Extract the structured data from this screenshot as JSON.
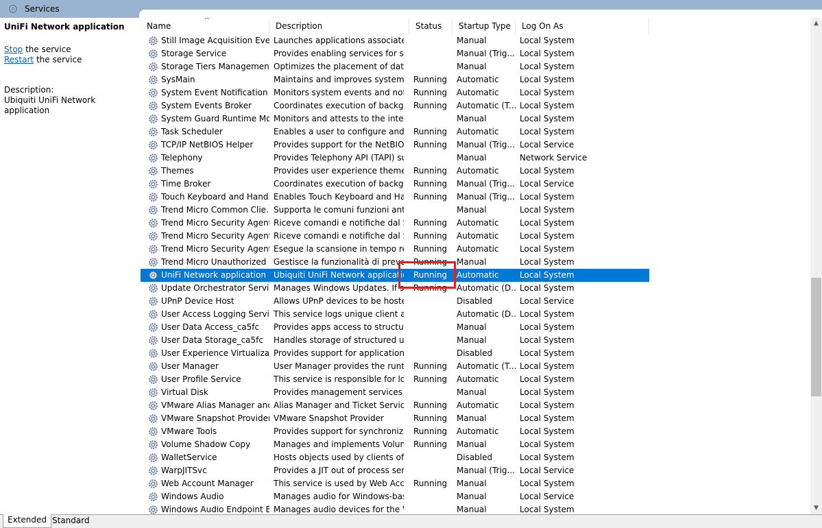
{
  "window": {
    "title": "Services",
    "icon": "gear-icon"
  },
  "left_pane": {
    "service_title": "UniFi Network application",
    "actions": [
      {
        "link": "Stop",
        "rest": " the service"
      },
      {
        "link": "Restart",
        "rest": " the service"
      }
    ],
    "description_label": "Description:",
    "description_text": "Ubiquiti UniFi Network application"
  },
  "columns": {
    "name": "Name",
    "description": "Description",
    "status": "Status",
    "startup_type": "Startup Type",
    "log_on_as": "Log On As",
    "sort_indicator": "^"
  },
  "services": [
    {
      "name": "Still Image Acquisition Events",
      "description": "Launches applications associated ...",
      "status": "",
      "startup": "Manual",
      "logon": "Local System"
    },
    {
      "name": "Storage Service",
      "description": "Provides enabling services for stor...",
      "status": "",
      "startup": "Manual (Trig...",
      "logon": "Local System"
    },
    {
      "name": "Storage Tiers Management",
      "description": "Optimizes the placement of data i...",
      "status": "",
      "startup": "Manual",
      "logon": "Local System"
    },
    {
      "name": "SysMain",
      "description": "Maintains and improves system pe...",
      "status": "Running",
      "startup": "Automatic",
      "logon": "Local System"
    },
    {
      "name": "System Event Notification S...",
      "description": "Monitors system events and notifi...",
      "status": "Running",
      "startup": "Automatic",
      "logon": "Local System"
    },
    {
      "name": "System Events Broker",
      "description": "Coordinates execution of backgro...",
      "status": "Running",
      "startup": "Automatic (T...",
      "logon": "Local System"
    },
    {
      "name": "System Guard Runtime Mo...",
      "description": "Monitors and attests to the integrit...",
      "status": "",
      "startup": "Manual",
      "logon": "Local System"
    },
    {
      "name": "Task Scheduler",
      "description": "Enables a user to configure and sc...",
      "status": "Running",
      "startup": "Automatic",
      "logon": "Local System"
    },
    {
      "name": "TCP/IP NetBIOS Helper",
      "description": "Provides support for the NetBIOS ...",
      "status": "Running",
      "startup": "Manual (Trig...",
      "logon": "Local Service"
    },
    {
      "name": "Telephony",
      "description": "Provides Telephony API (TAPI) sup...",
      "status": "",
      "startup": "Manual",
      "logon": "Network Service"
    },
    {
      "name": "Themes",
      "description": "Provides user experience theme m...",
      "status": "Running",
      "startup": "Automatic",
      "logon": "Local System"
    },
    {
      "name": "Time Broker",
      "description": "Coordinates execution of backgro...",
      "status": "Running",
      "startup": "Manual (Trig...",
      "logon": "Local Service"
    },
    {
      "name": "Touch Keyboard and Hand...",
      "description": "Enables Touch Keyboard and Han...",
      "status": "Running",
      "startup": "Manual (Trig...",
      "logon": "Local System"
    },
    {
      "name": "Trend Micro Common Clie...",
      "description": "Supporta le comuni funzioni anti-...",
      "status": "",
      "startup": "Manual",
      "logon": "Local System"
    },
    {
      "name": "Trend Micro Security Agent",
      "description": "Riceve comandi e notifiche dal Sec...",
      "status": "Running",
      "startup": "Automatic",
      "logon": "Local System"
    },
    {
      "name": "Trend Micro Security Agent ...",
      "description": "Riceve comandi e notifiche dal Sec...",
      "status": "Running",
      "startup": "Automatic",
      "logon": "Local System"
    },
    {
      "name": "Trend Micro Security Agent ...",
      "description": "Esegue la scansione in tempo reale...",
      "status": "Running",
      "startup": "Automatic",
      "logon": "Local System"
    },
    {
      "name": "Trend Micro Unauthorized ...",
      "description": "Gestisce la funzionalità di prevenzi...",
      "status": "Running",
      "startup": "Manual",
      "logon": "Local System"
    },
    {
      "name": "UniFi Network application",
      "description": "Ubiquiti UniFi Network application",
      "status": "Running",
      "startup": "Automatic",
      "logon": "Local System",
      "selected": true
    },
    {
      "name": "Update Orchestrator Service",
      "description": "Manages Windows Updates. If sto...",
      "status": "Running",
      "startup": "Automatic (D...",
      "logon": "Local System"
    },
    {
      "name": "UPnP Device Host",
      "description": "Allows UPnP devices to be hosted ...",
      "status": "",
      "startup": "Disabled",
      "logon": "Local Service"
    },
    {
      "name": "User Access Logging Service",
      "description": "This service logs unique client acc...",
      "status": "",
      "startup": "Automatic (D...",
      "logon": "Local System"
    },
    {
      "name": "User Data Access_ca5fc",
      "description": "Provides apps access to structured...",
      "status": "",
      "startup": "Manual",
      "logon": "Local System"
    },
    {
      "name": "User Data Storage_ca5fc",
      "description": "Handles storage of structured user...",
      "status": "",
      "startup": "Manual",
      "logon": "Local System"
    },
    {
      "name": "User Experience Virtualizatio...",
      "description": "Provides support for application a...",
      "status": "",
      "startup": "Disabled",
      "logon": "Local System"
    },
    {
      "name": "User Manager",
      "description": "User Manager provides the runtim...",
      "status": "Running",
      "startup": "Automatic (T...",
      "logon": "Local System"
    },
    {
      "name": "User Profile Service",
      "description": "This service is responsible for loadi...",
      "status": "Running",
      "startup": "Automatic",
      "logon": "Local System"
    },
    {
      "name": "Virtual Disk",
      "description": "Provides management services for...",
      "status": "",
      "startup": "Manual",
      "logon": "Local System"
    },
    {
      "name": "VMware Alias Manager and ...",
      "description": "Alias Manager and Ticket Service",
      "status": "Running",
      "startup": "Automatic",
      "logon": "Local System"
    },
    {
      "name": "VMware Snapshot Provider",
      "description": "VMware Snapshot Provider",
      "status": "Running",
      "startup": "Manual",
      "logon": "Local System"
    },
    {
      "name": "VMware Tools",
      "description": "Provides support for synchronizin...",
      "status": "Running",
      "startup": "Automatic",
      "logon": "Local System"
    },
    {
      "name": "Volume Shadow Copy",
      "description": "Manages and implements Volume ...",
      "status": "Running",
      "startup": "Manual",
      "logon": "Local System"
    },
    {
      "name": "WalletService",
      "description": "Hosts objects used by clients of th...",
      "status": "",
      "startup": "Disabled",
      "logon": "Local System"
    },
    {
      "name": "WarpJITSvc",
      "description": "Provides a JIT out of process servic...",
      "status": "",
      "startup": "Manual (Trig...",
      "logon": "Local Service"
    },
    {
      "name": "Web Account Manager",
      "description": "This service is used by Web Accou...",
      "status": "Running",
      "startup": "Manual",
      "logon": "Local System"
    },
    {
      "name": "Windows Audio",
      "description": "Manages audio for Windows-base...",
      "status": "",
      "startup": "Manual",
      "logon": "Local Service"
    },
    {
      "name": "Windows Audio Endpoint B...",
      "description": "Manages audio devices for the Wi...",
      "status": "",
      "startup": "Manual",
      "logon": "Local System"
    }
  ],
  "scrollbar": {
    "thumb_position": 0.7,
    "thumb_fraction": 0.25
  },
  "tabs": [
    {
      "label": "Extended",
      "active": true
    },
    {
      "label": "Standard",
      "active": false
    }
  ],
  "colors": {
    "selection": "#0078d7",
    "highlight_box": "#e0201c",
    "titlebar": "#99b4d1"
  }
}
